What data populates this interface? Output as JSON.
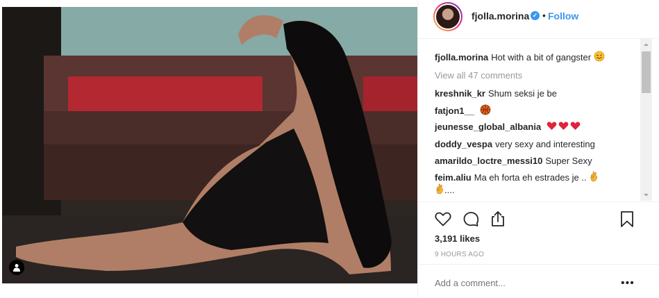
{
  "post": {
    "username": "fjolla.morina",
    "follow_label": "Follow",
    "dot": "•",
    "verified_mark": "✓",
    "caption": {
      "username": "fjolla.morina",
      "text": "Hot with a bit of gangster"
    },
    "view_all": "View all 47 comments",
    "comments": [
      {
        "username": "kreshnik_kr",
        "text": "Shum seksi je be"
      },
      {
        "username": "fatjon1__",
        "text": ""
      },
      {
        "username": "jeunesse_global_albania",
        "text": ""
      },
      {
        "username": "doddy_vespa",
        "text": "very sexy and interesting"
      },
      {
        "username": "amarildo_loctre_messi10",
        "text": "Super Sexy"
      },
      {
        "username": "feim.aliu",
        "text": "Ma eh forta eh estrades je .."
      },
      {
        "username": "",
        "text": "...."
      }
    ],
    "likes": "3,191 likes",
    "timestamp": "9 HOURS AGO",
    "add_comment_placeholder": "Add a comment...",
    "more_label": "•••",
    "icons": {
      "like": "heart-outline-icon",
      "comment": "comment-bubble-icon",
      "share": "share-icon",
      "save": "bookmark-icon",
      "user_tag": "user-tag-icon"
    }
  }
}
